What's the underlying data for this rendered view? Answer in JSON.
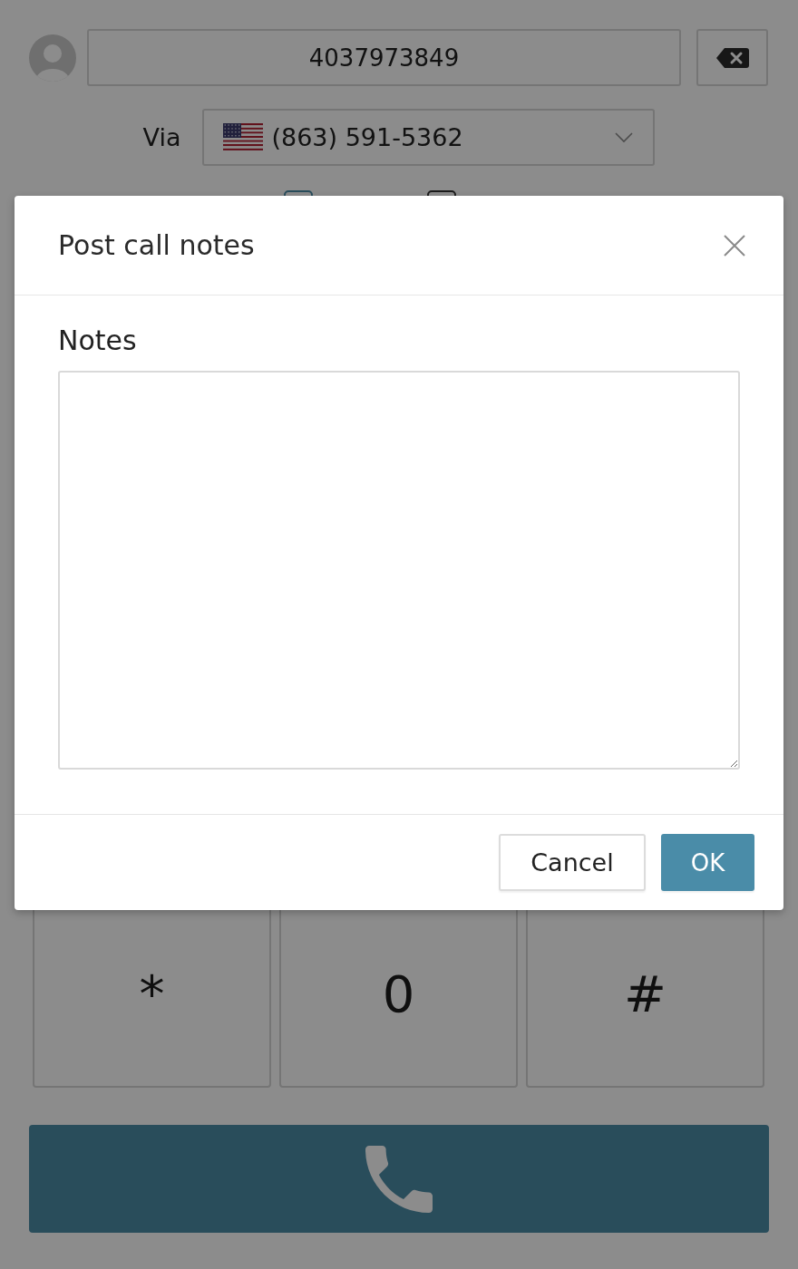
{
  "dialer": {
    "number": "4037973849",
    "via_label": "Via",
    "via_number": "(863) 591-5362"
  },
  "keypad": {
    "keys": [
      "*",
      "0",
      "#"
    ]
  },
  "dialog": {
    "title": "Post call notes",
    "notes": {
      "label": "Notes"
    },
    "buttons": [
      {
        "label": "Cancel",
        "kind": "secondary"
      },
      {
        "label": "OK",
        "kind": "primary"
      }
    ]
  }
}
